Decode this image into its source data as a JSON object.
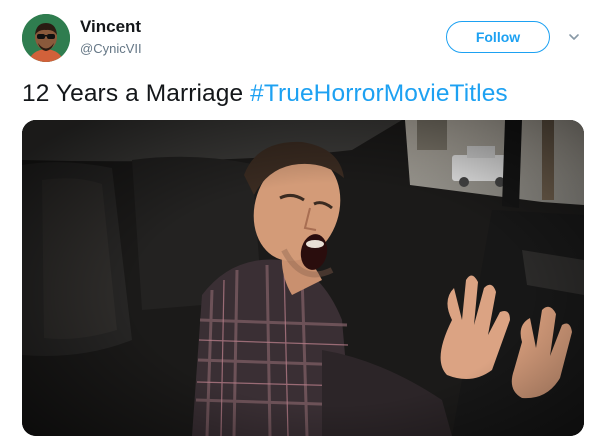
{
  "user": {
    "display_name": "Vincent",
    "handle": "@CynicVII"
  },
  "follow_button": {
    "label": "Follow"
  },
  "tweet": {
    "text_prefix": "12 Years a Marriage ",
    "hashtag": "#TrueHorrorMovieTitles"
  },
  "colors": {
    "accent": "#1da1f2",
    "text": "#14171a",
    "secondary": "#657786",
    "avatar_bg": "#2f7d4f"
  },
  "icons": {
    "more": "chevron-down-icon"
  }
}
